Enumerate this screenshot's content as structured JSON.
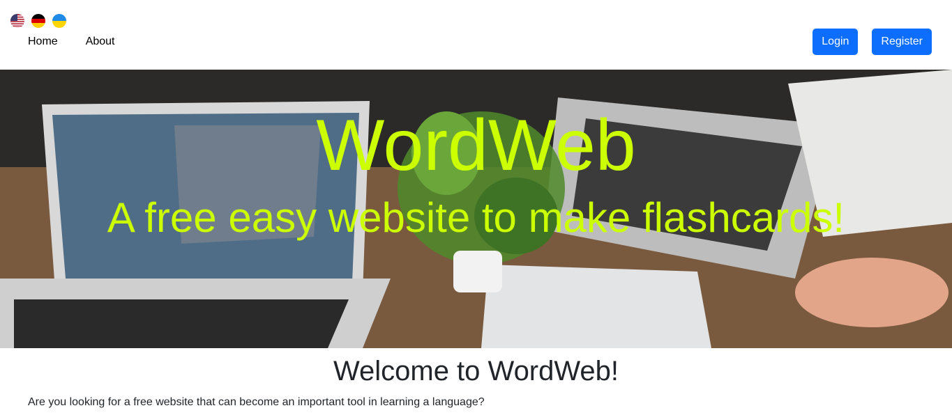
{
  "languages": [
    {
      "name": "english-flag-icon"
    },
    {
      "name": "german-flag-icon"
    },
    {
      "name": "ukrainian-flag-icon"
    }
  ],
  "nav": {
    "home": "Home",
    "about": "About",
    "login": "Login",
    "register": "Register"
  },
  "hero": {
    "title": "WordWeb",
    "subtitle": "A free easy website to make flashcards!"
  },
  "main": {
    "heading": "Welcome to WordWeb!",
    "intro": "Are you looking for a free website that can become an important tool in learning a language?"
  },
  "colors": {
    "accent_button": "#0d6efd",
    "hero_text": "#ccff00"
  }
}
